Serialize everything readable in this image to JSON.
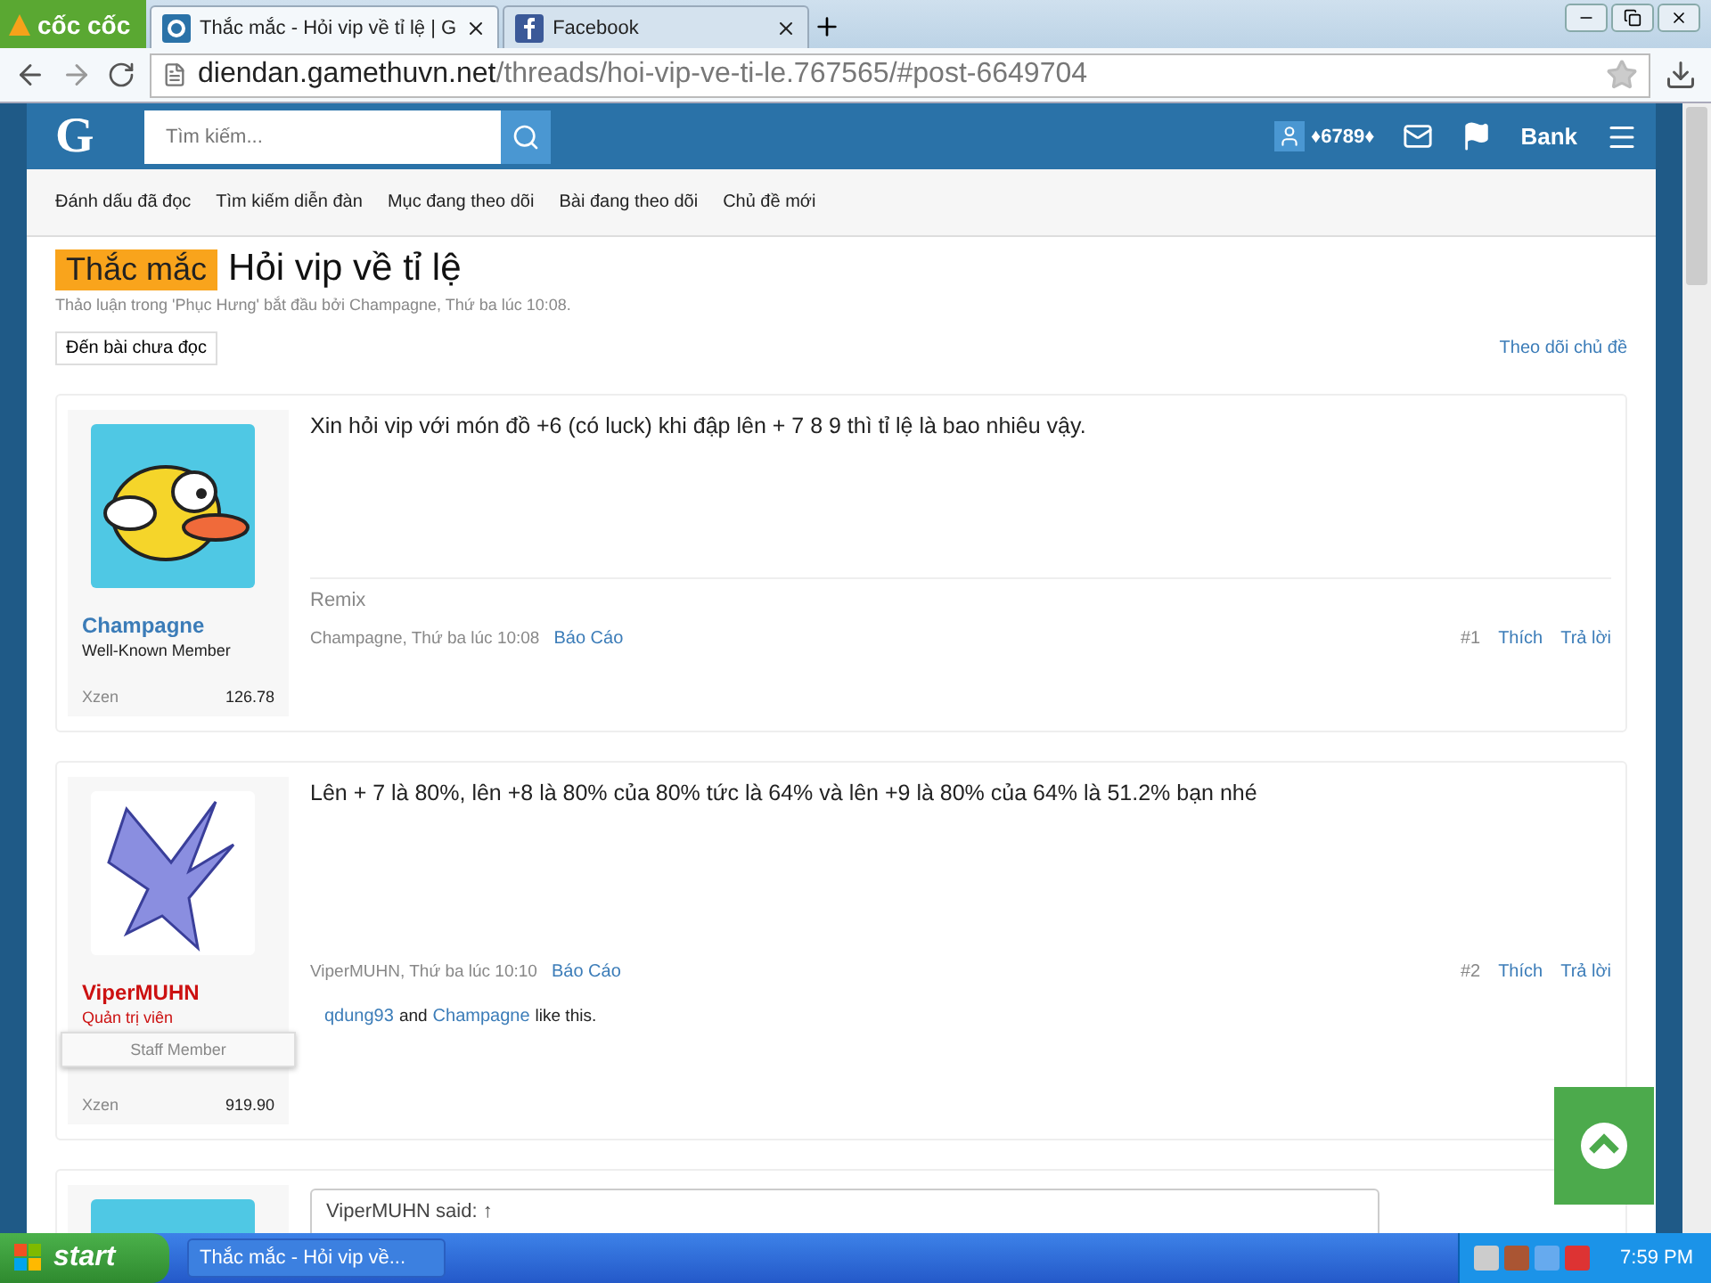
{
  "browser": {
    "brand": "cốc cốc",
    "tabs": [
      {
        "label": "Thắc mắc - Hỏi vip về tỉ lệ | G",
        "selected": true,
        "kind": "site"
      },
      {
        "label": "Facebook",
        "selected": false,
        "kind": "facebook"
      }
    ],
    "url_host": "diendan.gamethuvn.net",
    "url_path": "/threads/hoi-vip-ve-ti-le.767565/#post-6649704"
  },
  "header": {
    "logo": "G",
    "search_placeholder": "Tìm kiếm...",
    "points": "♦6789♦",
    "bank": "Bank"
  },
  "nav": [
    "Đánh dấu đã đọc",
    "Tìm kiếm diễn đàn",
    "Mục đang theo dõi",
    "Bài đang theo dõi",
    "Chủ đề mới"
  ],
  "thread": {
    "prefix": "Thắc mắc",
    "title": "Hỏi vip về tỉ lệ",
    "byline": "Thảo luận trong 'Phục Hưng' bắt đầu bởi Champagne, Thứ ba lúc 10:08.",
    "unread_button": "Đến bài chưa đọc",
    "watch_link": "Theo dõi chủ đề"
  },
  "posts": [
    {
      "kind": "bird",
      "username": "Champagne",
      "color": "#3b7cb8",
      "user_title": "Well-Known Member",
      "stat_label": "Xzen",
      "stat_value": "126.78",
      "message": "Xin hỏi vip với món đồ +6 (có luck) khi đập lên + 7 8 9 thì tỉ lệ là bao nhiêu vậy.",
      "signature": "Remix",
      "meta": "Champagne, Thứ ba lúc 10:08",
      "report": "Báo Cáo",
      "number": "#1",
      "like": "Thích",
      "reply": "Trả lời"
    },
    {
      "kind": "figure",
      "username": "ViperMUHN",
      "color": "#cc1111",
      "user_title": "Quản trị viên",
      "staff": "Staff Member",
      "stat_label": "Xzen",
      "stat_value": "919.90",
      "message": "Lên + 7 là 80%, lên +8 là 80% của 80% tức là 64% và lên +9 là 80% của 64% là 51.2% bạn nhé",
      "meta": "ViperMUHN, Thứ ba lúc 10:10",
      "report": "Báo Cáo",
      "number": "#2",
      "like": "Thích",
      "reply": "Trả lời",
      "likes": {
        "users": [
          "qdung93",
          "Champagne"
        ],
        "joiner": "and",
        "suffix": "like this."
      }
    },
    {
      "kind": "quote",
      "quote": "ViperMUHN said: ↑"
    }
  ],
  "taskbar": {
    "start": "start",
    "window": "Thắc mắc - Hỏi vip về...",
    "clock": "7:59 PM"
  }
}
